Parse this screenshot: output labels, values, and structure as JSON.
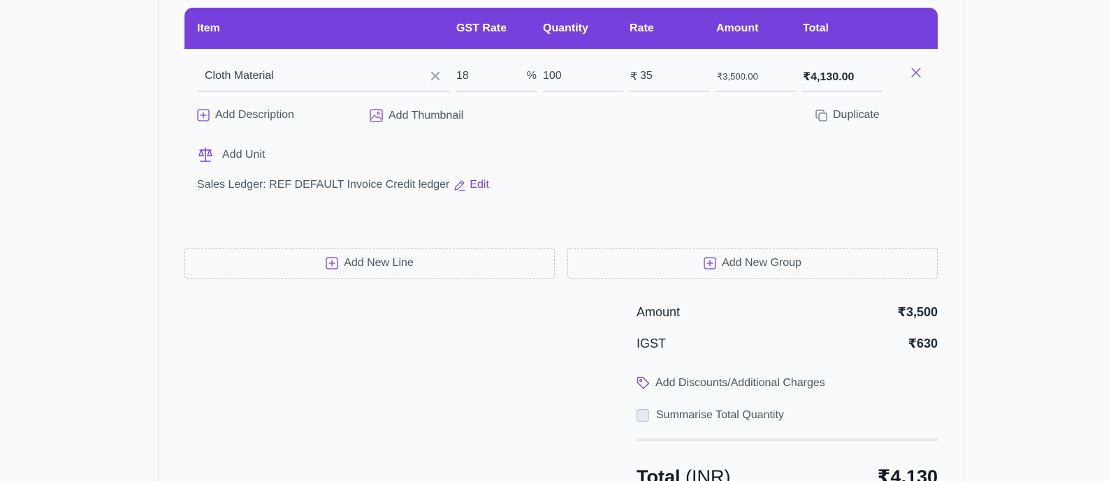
{
  "table": {
    "headers": [
      "Item",
      "GST Rate",
      "Quantity",
      "Rate",
      "Amount",
      "Total"
    ]
  },
  "line": {
    "item": "Cloth Material",
    "gst_rate": "18",
    "gst_suffix": "%",
    "quantity": "100",
    "rate_prefix": "₹",
    "rate": "35",
    "amount": "₹3,500.00",
    "total": "₹4,130.00"
  },
  "actions": {
    "add_description": "Add Description",
    "add_thumbnail": "Add Thumbnail",
    "duplicate": "Duplicate",
    "add_unit": "Add Unit",
    "ledger_text": "Sales Ledger: REF DEFAULT Invoice Credit ledger",
    "edit": "Edit",
    "add_new_line": "Add New Line",
    "add_new_group": "Add New Group"
  },
  "summary": {
    "amount_label": "Amount",
    "amount_value": "₹3,500",
    "igst_label": "IGST",
    "igst_value": "₹630",
    "discounts_label": "Add Discounts/Additional Charges",
    "summarise_label": "Summarise Total Quantity",
    "summarise_checked": false,
    "total_label": "Total",
    "total_currency": "(INR)",
    "total_value": "₹4,130"
  },
  "colors": {
    "accent": "#7540dc",
    "background": "#f9fafb"
  },
  "icons": [
    "clear-icon",
    "remove-line-icon",
    "plus-square-icon",
    "image-icon",
    "copy-icon",
    "scale-icon",
    "pencil-icon",
    "tag-icon",
    "checkbox"
  ]
}
